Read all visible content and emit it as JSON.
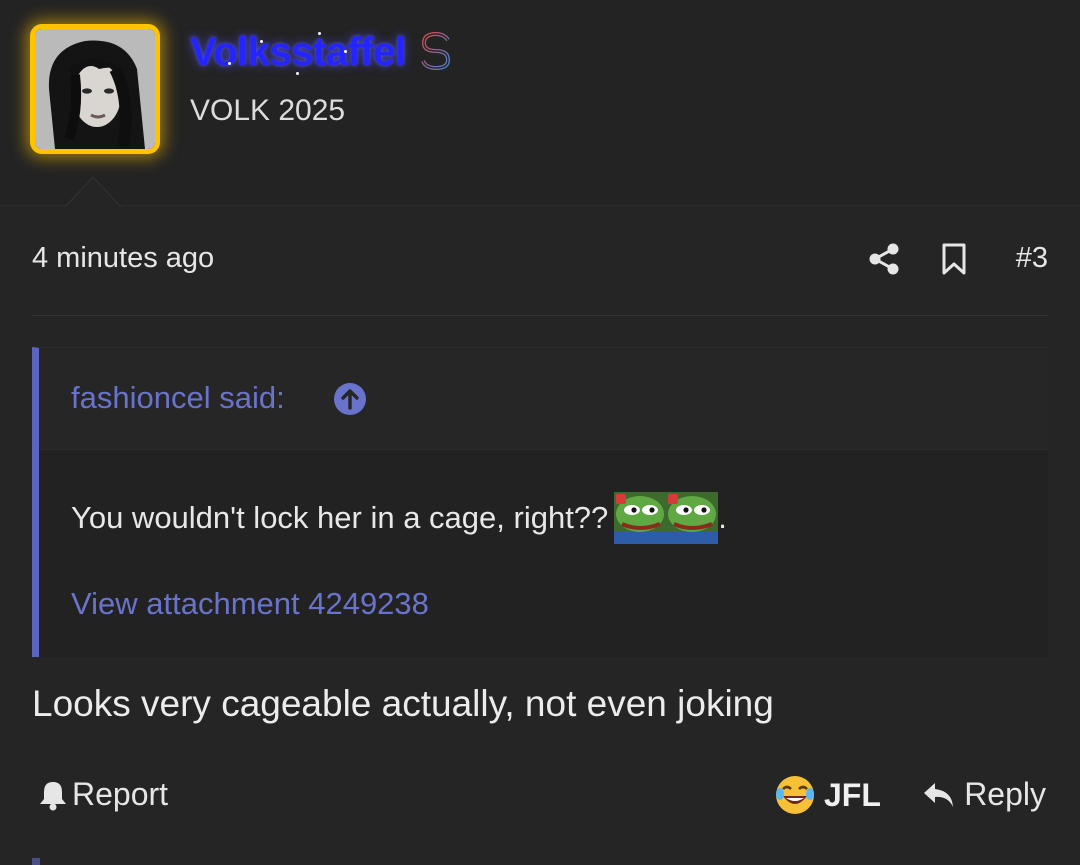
{
  "user": {
    "name": "Volksstaffel",
    "title": "VOLK 2025",
    "badge_icon": "dollar-icon",
    "name_color": "#2424ff",
    "frame_color": "#ffc400"
  },
  "post": {
    "timestamp": "4 minutes ago",
    "number": "#3",
    "body": "Looks very cageable actually, not even joking"
  },
  "quote": {
    "author": "fashioncel said:",
    "text": "You wouldn't lock her in a cage, right??",
    "text_suffix": ".",
    "emoji": [
      "pepe-emoji",
      "pepe-emoji"
    ],
    "attachment": "View attachment 4249238",
    "accent_color": "#5c64c2"
  },
  "actions": {
    "report": "Report",
    "reaction_label": "JFL",
    "reaction_emoji": "😂",
    "reply": "Reply"
  }
}
